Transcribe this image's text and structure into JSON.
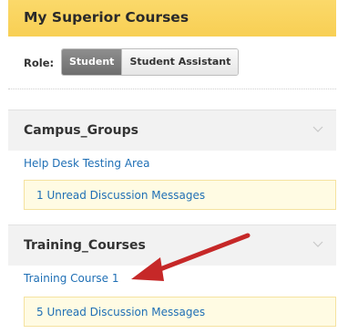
{
  "panel": {
    "title": "My Superior Courses"
  },
  "role": {
    "label": "Role:",
    "options": [
      "Student",
      "Student Assistant"
    ],
    "selected": "Student"
  },
  "groups": [
    {
      "title": "Campus_Groups",
      "courses": [
        {
          "name": "Help Desk Testing Area",
          "unread": "1 Unread Discussion Messages"
        }
      ]
    },
    {
      "title": "Training_Courses",
      "courses": [
        {
          "name": "Training Course 1",
          "unread": "5 Unread Discussion Messages"
        }
      ]
    }
  ],
  "colors": {
    "header": "#f8cf54",
    "link": "#1f6fb5",
    "arrow": "#c62828"
  },
  "icons": {
    "expand": "chevron-down-icon",
    "annotation": "red-arrow-icon"
  }
}
